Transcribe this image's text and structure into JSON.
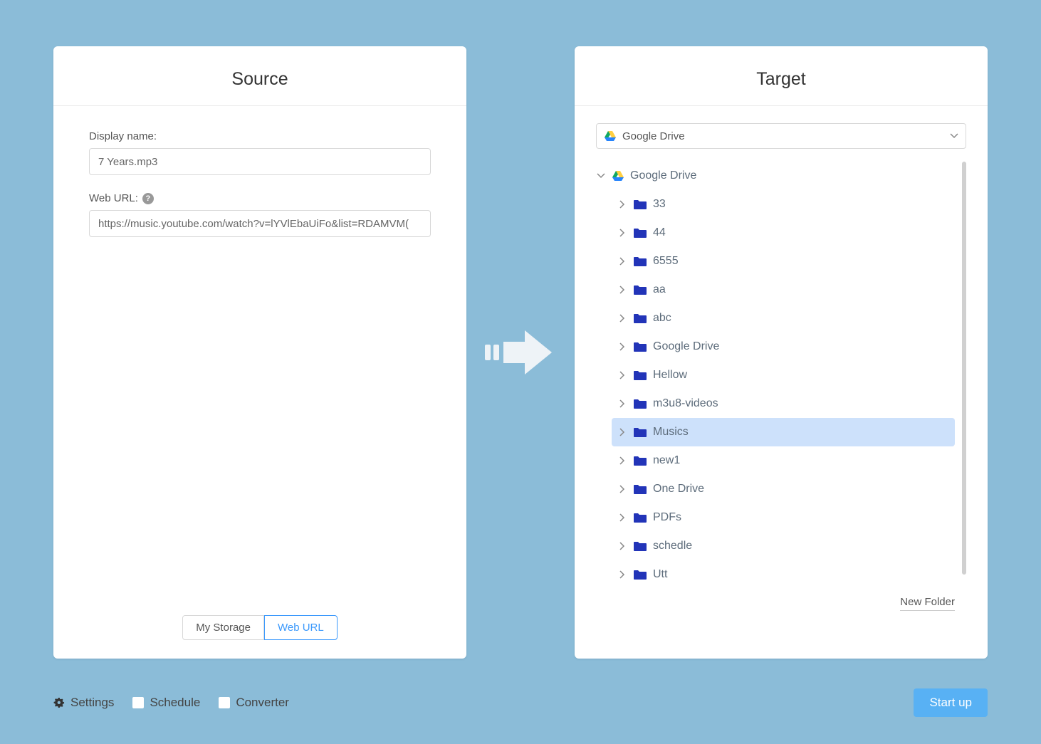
{
  "source": {
    "title": "Source",
    "display_name_label": "Display name:",
    "display_name_value": "7 Years.mp3",
    "web_url_label": "Web URL:",
    "web_url_value": "https://music.youtube.com/watch?v=lYVlEbaUiFo&list=RDAMVM(",
    "tabs": {
      "my_storage": "My Storage",
      "web_url": "Web URL"
    }
  },
  "target": {
    "title": "Target",
    "dropdown_selected": "Google Drive",
    "root_label": "Google Drive",
    "folders": [
      {
        "name": "33"
      },
      {
        "name": "44"
      },
      {
        "name": "6555"
      },
      {
        "name": "aa"
      },
      {
        "name": "abc"
      },
      {
        "name": "Google Drive"
      },
      {
        "name": "Hellow"
      },
      {
        "name": "m3u8-videos"
      },
      {
        "name": "Musics",
        "selected": true
      },
      {
        "name": "new1"
      },
      {
        "name": "One Drive"
      },
      {
        "name": "PDFs"
      },
      {
        "name": "schedle"
      },
      {
        "name": "Utt"
      }
    ],
    "new_folder_label": "New Folder"
  },
  "footer": {
    "settings": "Settings",
    "schedule": "Schedule",
    "converter": "Converter",
    "startup": "Start up"
  }
}
